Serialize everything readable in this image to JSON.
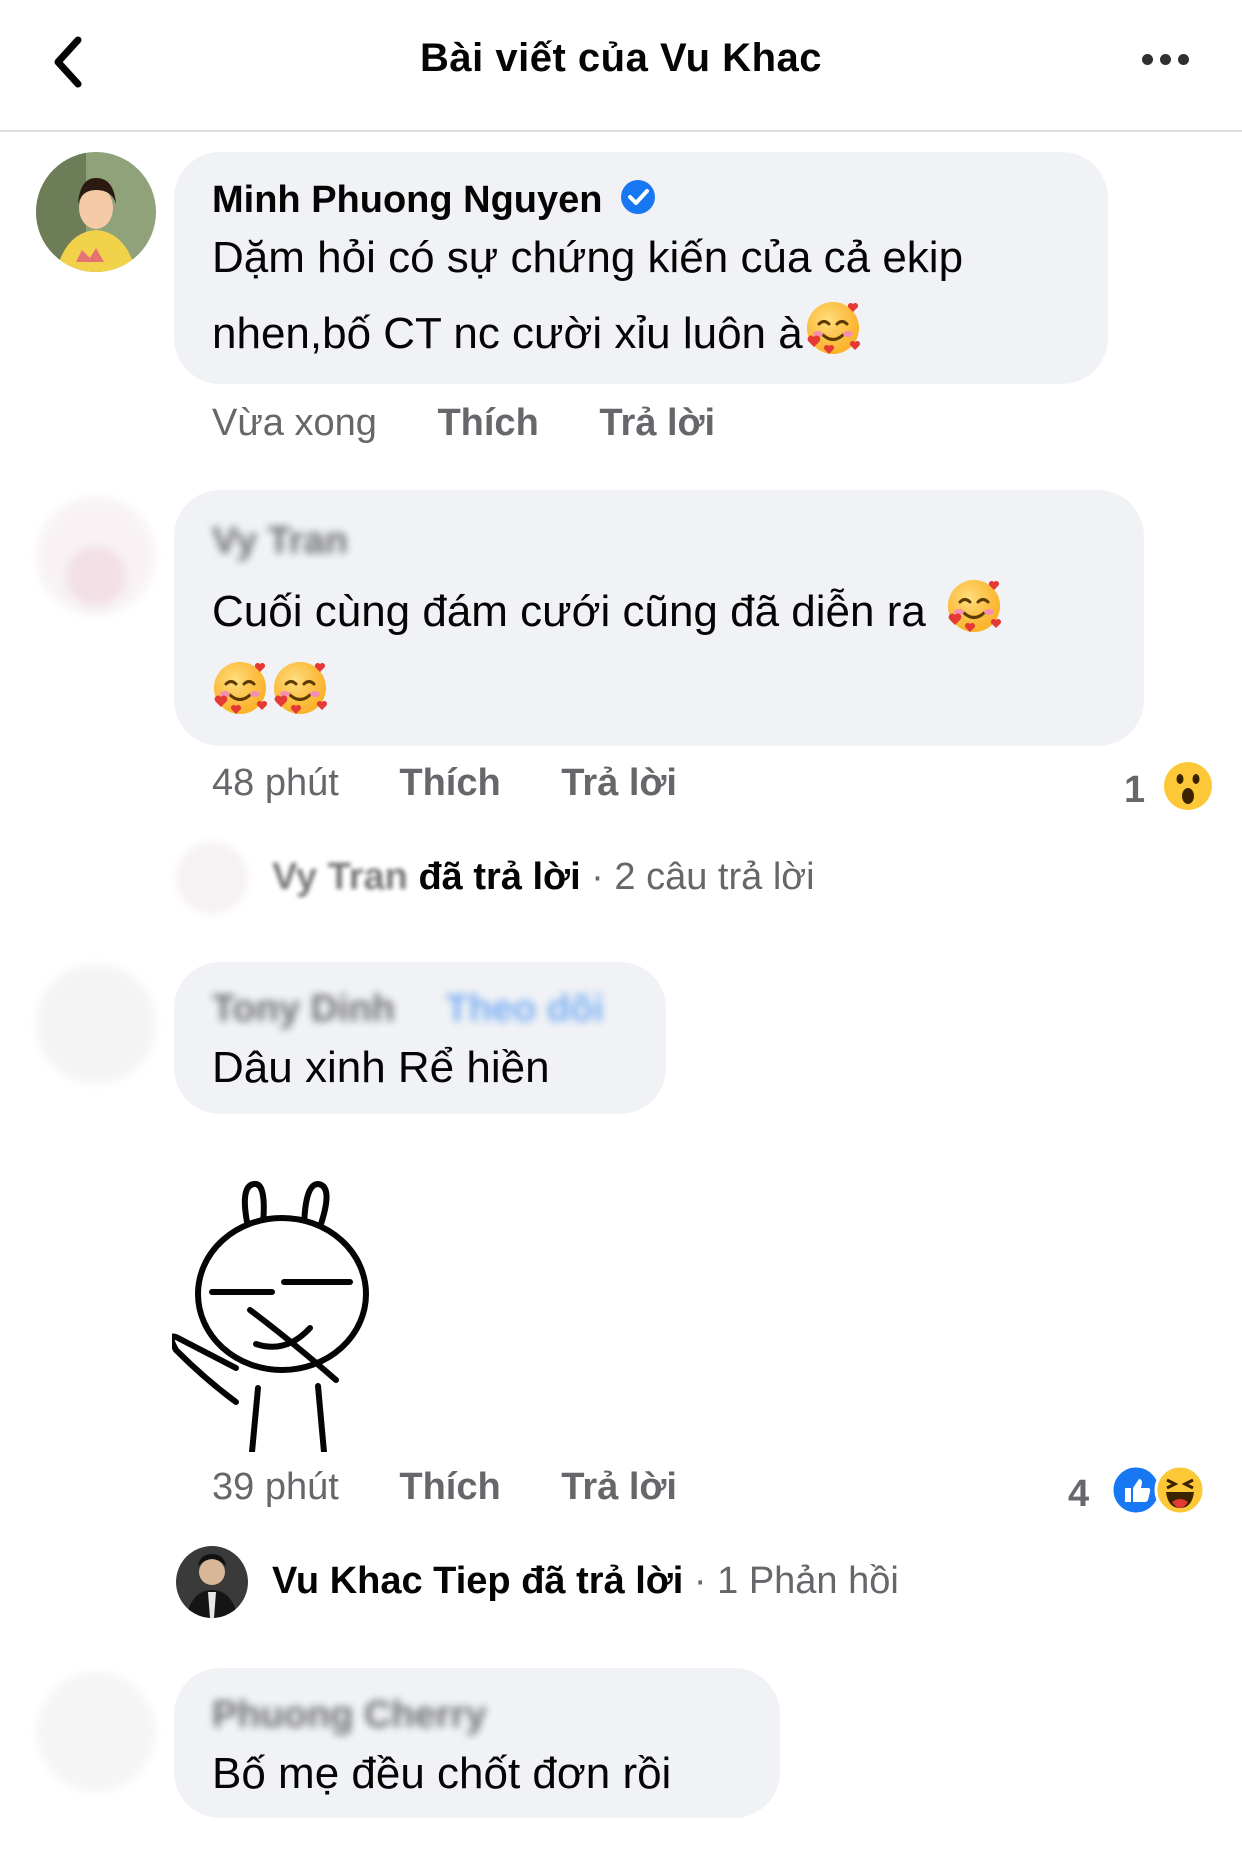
{
  "header": {
    "title": "Bài viết của Vu Khac"
  },
  "comments": [
    {
      "name": "Minh Phuong Nguyen",
      "text_line1": "Dặm hỏi có sự chứng kiến của cả ekip",
      "text_line2": "nhen,bố CT nc cười xỉu luôn à",
      "time": "Vừa xong",
      "like": "Thích",
      "reply": "Trả lời"
    },
    {
      "name": "Vy Tran",
      "text_line1": "Cuối cùng đám cưới cũng đã diễn ra",
      "time": "48 phút",
      "like": "Thích",
      "reply": "Trả lời",
      "reaction_count": "1",
      "replies_name": "Vy Tran",
      "replies_verb": "đã trả lời",
      "replies_count": " · 2 câu trả lời"
    },
    {
      "name": "Tony Dinh",
      "follow": "Theo dõi",
      "text_line1": "Dâu xinh Rể hiền",
      "time": "39 phút",
      "like": "Thích",
      "reply": "Trả lời",
      "reaction_count": "4",
      "replies_name": "Vu Khac Tiep",
      "replies_verb": "đã trả lời",
      "replies_count": " · 1 Phản hồi"
    },
    {
      "name": "Phuong Cherry",
      "text_line1": "Bố mẹ đều chốt đơn rồi"
    }
  ],
  "icons": {
    "back": "chevron-left-icon",
    "more": "more-dots-icon",
    "verified": "verified-badge-icon",
    "emoji": "smiling-face-with-hearts",
    "wow": "wow-reaction",
    "like": "like-reaction",
    "haha": "haha-reaction"
  },
  "colors": {
    "accent": "#1877f2",
    "bubble": "#f0f2f5",
    "muted": "#65676b"
  }
}
